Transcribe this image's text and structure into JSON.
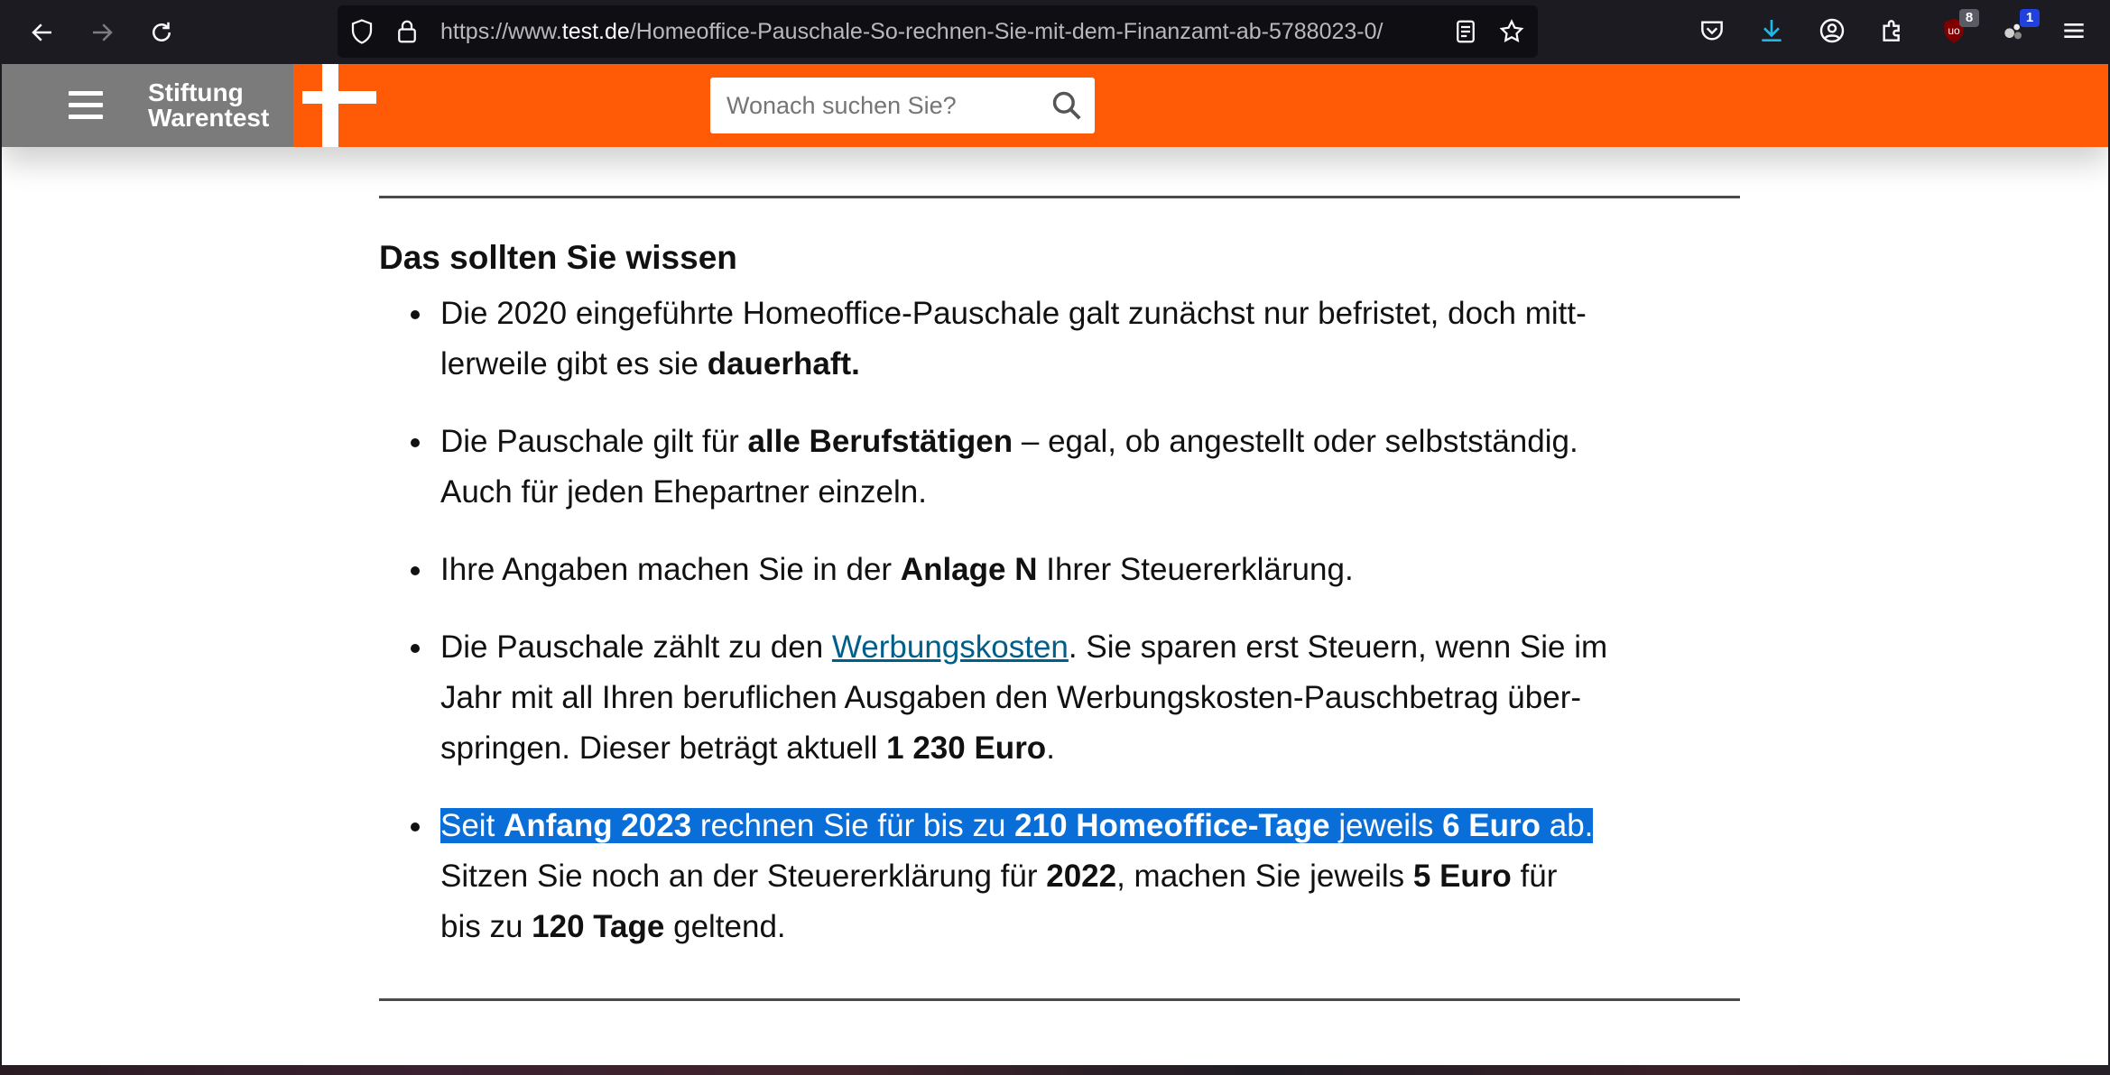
{
  "browser": {
    "url_prefix": "https://www.",
    "url_host": "test.de",
    "url_path": "/Homeoffice-Pauschale-So-rechnen-Sie-mit-dem-Finanzamt-ab-5788023-0/",
    "extension_badges": {
      "ublock": "8",
      "other": "1"
    }
  },
  "header": {
    "brand_line1": "Stiftung",
    "brand_line2": "Warentest",
    "search_placeholder": "Wonach suchen Sie?",
    "accent_color": "#ff5a05"
  },
  "article": {
    "heading": "Das sollten Sie wissen",
    "items": [
      {
        "t1": "Die 2020 eingeführte Homeoffice-Pauschale galt zunächst nur befristet, doch mitt-",
        "t2": "lerweile gibt es sie ",
        "b1": "dauerhaft."
      },
      {
        "t1": "Die Pauschale gilt für ",
        "b1": "alle Berufstätigen",
        "t2": " – egal, ob angestellt oder selbstständig.",
        "t3": "Auch für jeden Ehepartner einzeln."
      },
      {
        "t1": "Ihre Angaben machen Sie in der ",
        "b1": "Anlage N",
        "t2": " Ihrer Steuererklärung."
      },
      {
        "t1": "Die Pauschale zählt zu den ",
        "link": "Werbungskosten",
        "t2": ". Sie sparen erst Steuern, wenn Sie im",
        "t3": "Jahr mit all Ihren beruflichen Ausgaben den Werbungskosten-Pauschbetrag über-",
        "t4": "springen. Dieser beträgt aktuell ",
        "b1": "1 230 Euro",
        "t5": "."
      },
      {
        "s1": "Seit ",
        "sb1": "Anfang 2023",
        "s2": " rechnen Sie für bis zu ",
        "sb2": "210 Homeoffice-Tage",
        "s3": " jeweils ",
        "sb3": "6 Euro",
        "s4": " ab. ",
        "t1": "Sitzen Sie noch an der Steuererklärung für ",
        "b1": "2022",
        "t2": ", machen Sie jeweils ",
        "b2": "5 Euro",
        "t3": " für",
        "t4": "bis zu ",
        "b3": "120 Tage",
        "t5": " geltend."
      }
    ]
  }
}
